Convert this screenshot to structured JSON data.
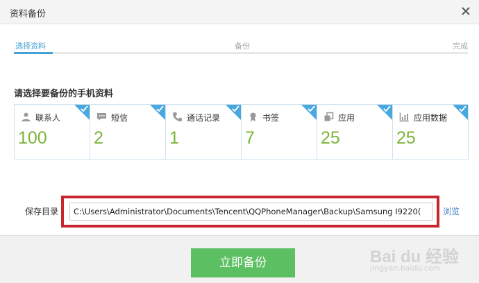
{
  "window": {
    "title": "资料备份"
  },
  "steps": [
    {
      "label": "选择资料",
      "active": true
    },
    {
      "label": "备份",
      "active": false
    },
    {
      "label": "完成",
      "active": false
    }
  ],
  "section_title": "请选择要备份的手机资料",
  "cards": [
    {
      "label": "联系人",
      "count": "100",
      "icon": "person-icon",
      "checked": true
    },
    {
      "label": "短信",
      "count": "2",
      "icon": "message-icon",
      "checked": true
    },
    {
      "label": "通话记录",
      "count": "1",
      "icon": "phone-icon",
      "checked": true
    },
    {
      "label": "书签",
      "count": "7",
      "icon": "bookmark-icon",
      "checked": true
    },
    {
      "label": "应用",
      "count": "25",
      "icon": "app-icon",
      "checked": true
    },
    {
      "label": "应用数据",
      "count": "25",
      "icon": "chart-icon",
      "checked": true
    }
  ],
  "save": {
    "label": "保存目录",
    "path": "C:\\Users\\Administrator\\Documents\\Tencent\\QQPhoneManager\\Backup\\Samsung I9220(",
    "browse_label": "浏览"
  },
  "footer": {
    "backup_button": "立即备份"
  },
  "watermark": {
    "brand": "Bai du 经验",
    "sub": "jingyan.baidu.com"
  },
  "colors": {
    "accent": "#46a1d9",
    "count_green": "#7bb53a",
    "button_green": "#5cbf62",
    "highlight_red": "#c8262d",
    "check_blue": "#4aa8e0"
  }
}
